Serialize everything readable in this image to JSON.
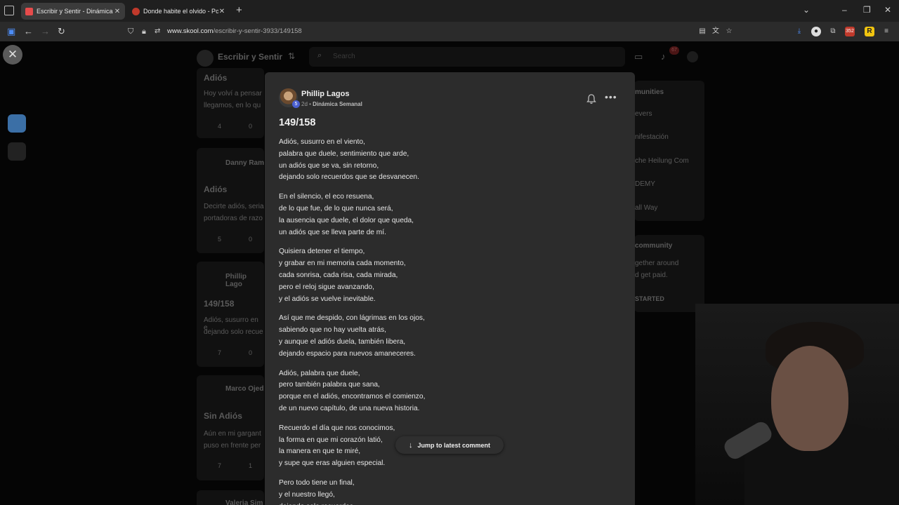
{
  "browser": {
    "tabs": [
      {
        "title": "Escribir y Sentir - Dinámica Sem",
        "active": true
      },
      {
        "title": "Donde habite el olvido - Poema",
        "active": false
      }
    ],
    "url_host": "www.skool.com",
    "url_path": "/escribir-y-sentir-3933/149158",
    "ext_badge": "352"
  },
  "background": {
    "group_name": "Escribir y Sentir",
    "search_placeholder": "Search",
    "notif_count": "67",
    "feed_items": [
      {
        "heading": "Adiós",
        "excerpt1": "Hoy volví a pensar",
        "excerpt2": "llegamos, en lo qu",
        "likes": "4",
        "comments": "0"
      },
      {
        "author": "Danny Ram",
        "heading": "Adiós",
        "excerpt1": "Decirte adiós, seria",
        "excerpt2": "portadoras de razo",
        "likes": "5",
        "comments": "0"
      },
      {
        "author": "Phillip Lago",
        "heading": "149/158",
        "excerpt1": "Adiós, susurro en e",
        "excerpt2": "dejando solo recue",
        "likes": "7",
        "comments": "0"
      },
      {
        "author": "Marco Ojed",
        "heading": "Sin Adiós",
        "excerpt1": "Aún en mi gargant",
        "excerpt2": "puso en frente per",
        "likes": "7",
        "comments": "1"
      },
      {
        "author": "Valeria Sim"
      }
    ],
    "right_items": [
      "munities",
      "evers",
      "nifestación",
      "che Heilung Com",
      "DEMY",
      "all Way",
      "community",
      "gether around",
      "d get paid.",
      "STARTED"
    ]
  },
  "post": {
    "author": "Phillip Lagos",
    "level": "5",
    "time": "2d",
    "category": "Dinámica Semanal",
    "title": "149/158",
    "stanzas": [
      [
        "Adiós, susurro en el viento,",
        "palabra que duele, sentimiento que arde,",
        "un adiós que se va, sin retorno,",
        "dejando solo recuerdos que se desvanecen."
      ],
      [
        "En el silencio, el eco resuena,",
        "de lo que fue, de lo que nunca será,",
        "la ausencia que duele, el dolor que queda,",
        "un adiós que se lleva parte de mí."
      ],
      [
        "Quisiera detener el tiempo,",
        "y grabar en mi memoria cada momento,",
        "cada sonrisa, cada risa, cada mirada,",
        "pero el reloj sigue avanzando,",
        "y el adiós se vuelve inevitable."
      ],
      [
        "Así que me despido, con lágrimas en los ojos,",
        "sabiendo que no hay vuelta atrás,",
        "y aunque el adiós duela, también libera,",
        "dejando espacio para nuevos amaneceres."
      ],
      [
        "Adiós, palabra que duele,",
        "pero también palabra que sana,",
        "porque en el adiós, encontramos el comienzo,",
        "de un nuevo capítulo, de una nueva historia."
      ],
      [
        "Recuerdo el día que nos conocimos,",
        "la forma en que mi corazón latió,",
        "la manera en que te miré,",
        "y supe que eras alguien especial."
      ],
      [
        "Pero todo tiene un final,",
        "y el nuestro llegó,",
        "dejando solo recuerdos"
      ]
    ]
  },
  "jump_button": "Jump to latest comment"
}
